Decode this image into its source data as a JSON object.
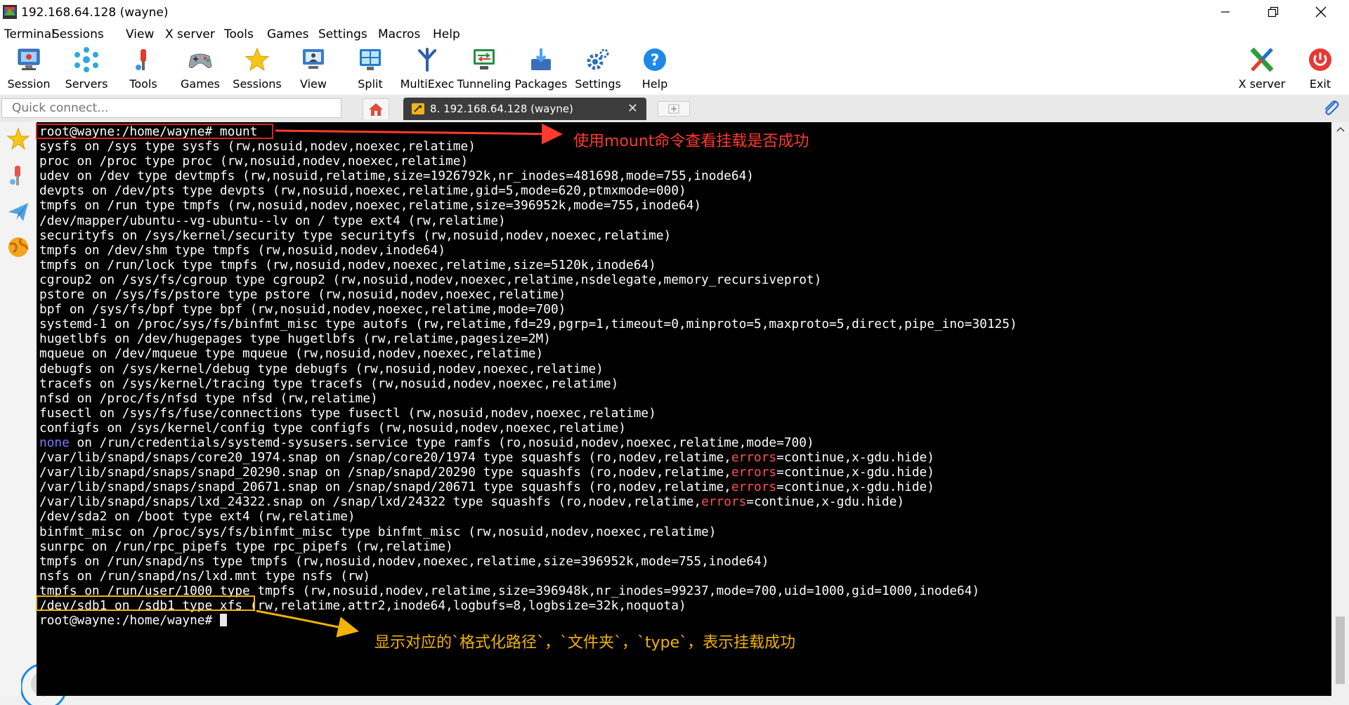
{
  "window": {
    "title": "192.168.64.128 (wayne)",
    "controls": {
      "minimize": "—",
      "maximize": "❐",
      "close": "✕"
    }
  },
  "menu": [
    "Terminal",
    "Sessions",
    "View",
    "X server",
    "Tools",
    "Games",
    "Settings",
    "Macros",
    "Help"
  ],
  "toolbar": {
    "items": [
      {
        "label": "Session",
        "icon": "session-icon"
      },
      {
        "label": "Servers",
        "icon": "servers-icon"
      },
      {
        "label": "Tools",
        "icon": "tools-icon"
      },
      {
        "label": "Games",
        "icon": "games-icon"
      },
      {
        "label": "Sessions",
        "icon": "sessions-star-icon"
      },
      {
        "label": "View",
        "icon": "view-icon"
      },
      {
        "label": "Split",
        "icon": "split-icon"
      },
      {
        "label": "MultiExec",
        "icon": "multiexec-icon"
      },
      {
        "label": "Tunneling",
        "icon": "tunneling-icon"
      },
      {
        "label": "Packages",
        "icon": "packages-icon"
      },
      {
        "label": "Settings",
        "icon": "settings-gear-icon"
      },
      {
        "label": "Help",
        "icon": "help-icon"
      }
    ],
    "right_items": [
      {
        "label": "X server",
        "icon": "xserver-icon"
      },
      {
        "label": "Exit",
        "icon": "exit-power-icon"
      }
    ]
  },
  "tabs": {
    "quick_connect_placeholder": "Quick connect...",
    "active_tab_label": "8. 192.168.64.128 (wayne)",
    "close_glyph": "✕",
    "new_tab_glyph": "+"
  },
  "terminal": {
    "lines": [
      [
        {
          "t": "root@wayne:/home/wayne# mount"
        }
      ],
      [
        {
          "t": "sysfs on /sys type sysfs (rw,nosuid,nodev,noexec,relatime)"
        }
      ],
      [
        {
          "t": "proc on /proc type proc (rw,nosuid,nodev,noexec,relatime)"
        }
      ],
      [
        {
          "t": "udev on /dev type devtmpfs (rw,nosuid,relatime,size=1926792k,nr_inodes=481698,mode=755,inode64)"
        }
      ],
      [
        {
          "t": "devpts on /dev/pts type devpts (rw,nosuid,noexec,relatime,gid=5,mode=620,ptmxmode=000)"
        }
      ],
      [
        {
          "t": "tmpfs on /run type tmpfs (rw,nosuid,nodev,noexec,relatime,size=396952k,mode=755,inode64)"
        }
      ],
      [
        {
          "t": "/dev/mapper/ubuntu--vg-ubuntu--lv on / type ext4 (rw,relatime)"
        }
      ],
      [
        {
          "t": "securityfs on /sys/kernel/security type securityfs (rw,nosuid,nodev,noexec,relatime)"
        }
      ],
      [
        {
          "t": "tmpfs on /dev/shm type tmpfs (rw,nosuid,nodev,inode64)"
        }
      ],
      [
        {
          "t": "tmpfs on /run/lock type tmpfs (rw,nosuid,nodev,noexec,relatime,size=5120k,inode64)"
        }
      ],
      [
        {
          "t": "cgroup2 on /sys/fs/cgroup type cgroup2 (rw,nosuid,nodev,noexec,relatime,nsdelegate,memory_recursiveprot)"
        }
      ],
      [
        {
          "t": "pstore on /sys/fs/pstore type pstore (rw,nosuid,nodev,noexec,relatime)"
        }
      ],
      [
        {
          "t": "bpf on /sys/fs/bpf type bpf (rw,nosuid,nodev,noexec,relatime,mode=700)"
        }
      ],
      [
        {
          "t": "systemd-1 on /proc/sys/fs/binfmt_misc type autofs (rw,relatime,fd=29,pgrp=1,timeout=0,minproto=5,maxproto=5,direct,pipe_ino=30125)"
        }
      ],
      [
        {
          "t": "hugetlbfs on /dev/hugepages type hugetlbfs (rw,relatime,pagesize=2M)"
        }
      ],
      [
        {
          "t": "mqueue on /dev/mqueue type mqueue (rw,nosuid,nodev,noexec,relatime)"
        }
      ],
      [
        {
          "t": "debugfs on /sys/kernel/debug type debugfs (rw,nosuid,nodev,noexec,relatime)"
        }
      ],
      [
        {
          "t": "tracefs on /sys/kernel/tracing type tracefs (rw,nosuid,nodev,noexec,relatime)"
        }
      ],
      [
        {
          "t": "nfsd on /proc/fs/nfsd type nfsd (rw,relatime)"
        }
      ],
      [
        {
          "t": "fusectl on /sys/fs/fuse/connections type fusectl (rw,nosuid,nodev,noexec,relatime)"
        }
      ],
      [
        {
          "t": "configfs on /sys/kernel/config type configfs (rw,nosuid,nodev,noexec,relatime)"
        }
      ],
      [
        {
          "t": "none",
          "c": "blue"
        },
        {
          "t": " on /run/credentials/systemd-sysusers.service type ramfs (ro,nosuid,nodev,noexec,relatime,mode=700)"
        }
      ],
      [
        {
          "t": "/var/lib/snapd/snaps/core20_1974.snap on /snap/core20/1974 type squashfs (ro,nodev,relatime,"
        },
        {
          "t": "errors",
          "c": "red"
        },
        {
          "t": "=continue,x-gdu.hide)"
        }
      ],
      [
        {
          "t": "/var/lib/snapd/snaps/snapd_20290.snap on /snap/snapd/20290 type squashfs (ro,nodev,relatime,"
        },
        {
          "t": "errors",
          "c": "red"
        },
        {
          "t": "=continue,x-gdu.hide)"
        }
      ],
      [
        {
          "t": "/var/lib/snapd/snaps/snapd_20671.snap on /snap/snapd/20671 type squashfs (ro,nodev,relatime,"
        },
        {
          "t": "errors",
          "c": "red"
        },
        {
          "t": "=continue,x-gdu.hide)"
        }
      ],
      [
        {
          "t": "/var/lib/snapd/snaps/lxd_24322.snap on /snap/lxd/24322 type squashfs (ro,nodev,relatime,"
        },
        {
          "t": "errors",
          "c": "red"
        },
        {
          "t": "=continue,x-gdu.hide)"
        }
      ],
      [
        {
          "t": "/dev/sda2 on /boot type ext4 (rw,relatime)"
        }
      ],
      [
        {
          "t": "binfmt_misc on /proc/sys/fs/binfmt_misc type binfmt_misc (rw,nosuid,nodev,noexec,relatime)"
        }
      ],
      [
        {
          "t": "sunrpc on /run/rpc_pipefs type rpc_pipefs (rw,relatime)"
        }
      ],
      [
        {
          "t": "tmpfs on /run/snapd/ns type tmpfs (rw,nosuid,nodev,noexec,relatime,size=396952k,mode=755,inode64)"
        }
      ],
      [
        {
          "t": "nsfs on /run/snapd/ns/lxd.mnt type nsfs (rw)"
        }
      ],
      [
        {
          "t": "tmpfs on /run/user/1000 type tmpfs (rw,nosuid,nodev,relatime,size=396948k,nr_inodes=99237,mode=700,uid=1000,gid=1000,inode64)"
        }
      ],
      [
        {
          "t": "/dev/sdb1 on /sdb1 type xfs (rw,relatime,attr2,inode64,logbufs=8,logbsize=32k,noquota)"
        }
      ],
      [
        {
          "t": "root@wayne:/home/wayne# "
        },
        {
          "t": "",
          "c": "cursor"
        }
      ]
    ]
  },
  "annotations": {
    "red_note": "使用mount命令查看挂载是否成功",
    "yellow_note": "显示对应的`格式化路径`，`文件夹`，`type`，表示挂载成功",
    "red_color": "#ff3a2f",
    "yellow_color": "#f2b400"
  },
  "sidebar": [
    "favorites-star-icon",
    "tools-icon",
    "send-icon",
    "macros-globe-icon"
  ]
}
